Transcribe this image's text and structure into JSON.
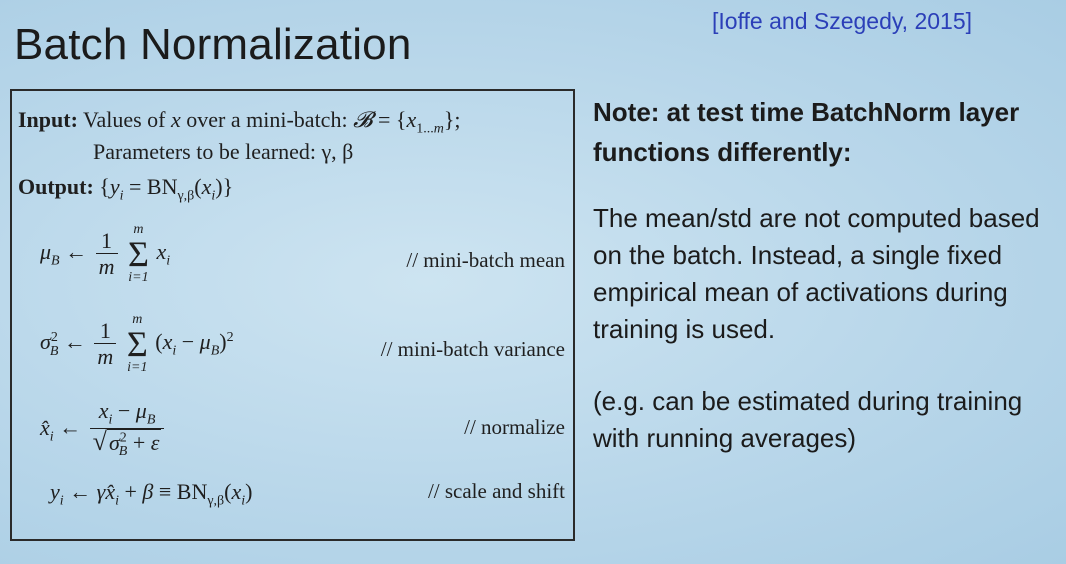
{
  "slide": {
    "title": "Batch Normalization",
    "citation": "[Ioffe and Szegedy, 2015]"
  },
  "algorithm": {
    "input_label": "Input:",
    "input_text": "Values of",
    "input_var": "x",
    "input_suffix": "over a mini-batch:",
    "batch_set": "𝓑 = {x1...m};",
    "params_text": "Parameters to be learned: γ, β",
    "output_label": "Output:",
    "output_expr": "{yi = BNγ,β(xi)}",
    "steps": [
      {
        "expr": "μB ← 1/m Σ xi",
        "comment": "// mini-batch mean"
      },
      {
        "expr": "σ²B ← 1/m Σ (xi − μB)²",
        "comment": "// mini-batch variance"
      },
      {
        "expr": "x̂i ← (xi − μB)/√(σ²B + ε)",
        "comment": "// normalize"
      },
      {
        "expr": "yi ← γx̂i + β ≡ BNγ,β(xi)",
        "comment": "// scale and shift"
      }
    ]
  },
  "note": {
    "heading": "Note: at test time BatchNorm layer functions differently:",
    "body": "The mean/std are not computed based on the batch. Instead, a single fixed empirical mean of activations during training is used.",
    "example": "(e.g. can be estimated during training with running averages)"
  }
}
